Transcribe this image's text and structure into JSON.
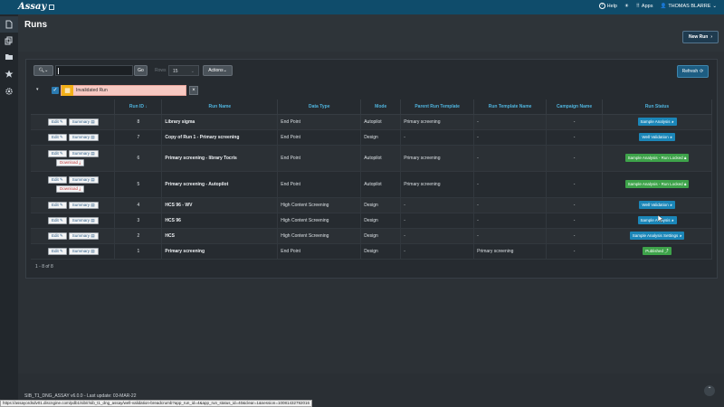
{
  "app": {
    "brand": "Assay"
  },
  "topbar": {
    "help": "Help",
    "apps": "Apps",
    "user": "THOMAS BLARRE"
  },
  "page": {
    "title": "Runs",
    "new_run": "New Run"
  },
  "toolbar": {
    "search_placeholder": "",
    "go": "Go",
    "rows_label": "Rows",
    "rows_value": "15",
    "actions": "Actions",
    "refresh": "Refresh"
  },
  "filter": {
    "label": "Invalidated Run"
  },
  "table": {
    "columns": [
      "",
      "Run ID",
      "Run Name",
      "Data Type",
      "Mode",
      "Parent Run Template",
      "Run Template Name",
      "Campaign Name",
      "Run Status"
    ],
    "rows": [
      {
        "run_id": "8",
        "run_name": "Library sigma",
        "data_type": "End Point",
        "mode": "Autopilot",
        "parent": "Primary screening",
        "template": "-",
        "campaign": "-",
        "status": "Sample Analysis",
        "status_color": "#1b86b8",
        "download": false
      },
      {
        "run_id": "7",
        "run_name": "Copy of Run 1 - Primary screening",
        "data_type": "End Point",
        "mode": "Design",
        "parent": "-",
        "template": "-",
        "campaign": "-",
        "status": "Well Validation",
        "status_color": "#1b86b8",
        "download": false
      },
      {
        "run_id": "6",
        "run_name": "Primary screening - library Tocris",
        "data_type": "End Point",
        "mode": "Autopilot",
        "parent": "Primary screening",
        "template": "-",
        "campaign": "-",
        "status": "Sample Analysis - Run Locked",
        "status_color": "#3ea34a",
        "download": true
      },
      {
        "run_id": "5",
        "run_name": "Primary screening - Autopilot",
        "data_type": "End Point",
        "mode": "Autopilot",
        "parent": "Primary screening",
        "template": "-",
        "campaign": "-",
        "status": "Sample Analysis - Run Locked",
        "status_color": "#3ea34a",
        "download": true
      },
      {
        "run_id": "4",
        "run_name": "HCS 96 - WV",
        "data_type": "High Content Screening",
        "mode": "Design",
        "parent": "-",
        "template": "-",
        "campaign": "-",
        "status": "Well Validation",
        "status_color": "#1b86b8",
        "download": false
      },
      {
        "run_id": "3",
        "run_name": "HCS 96",
        "data_type": "High Content Screening",
        "mode": "Design",
        "parent": "-",
        "template": "-",
        "campaign": "-",
        "status": "Sample Analysis",
        "status_color": "#1b86b8",
        "download": false
      },
      {
        "run_id": "2",
        "run_name": "HCS",
        "data_type": "High Content Screening",
        "mode": "Design",
        "parent": "-",
        "template": "-",
        "campaign": "-",
        "status": "Sample Analysis Settings",
        "status_color": "#1b86b8",
        "download": false
      },
      {
        "run_id": "1",
        "run_name": "Primary screening",
        "data_type": "End Point",
        "mode": "Design",
        "parent": "-",
        "template": "Primary screening",
        "campaign": "-",
        "status": "Published",
        "status_color": "#3ea34a",
        "download": false
      }
    ],
    "action_labels": {
      "edit": "Edit",
      "summary": "Summary",
      "download": "Download"
    },
    "count": "1 - 8 of 8"
  },
  "footer": {
    "version": "SIB_T1_DNG_ASSAY v6.0.0 - Last update: 03-MAR-22",
    "status_url": "https://assayordsdv01.discngine.com/pdb1/sib/r/sib_t1_dng_assay/well-validation-breadcrumb?app_run_id=4&app_run_status_id=40&clear=1&session=10081432792016"
  }
}
